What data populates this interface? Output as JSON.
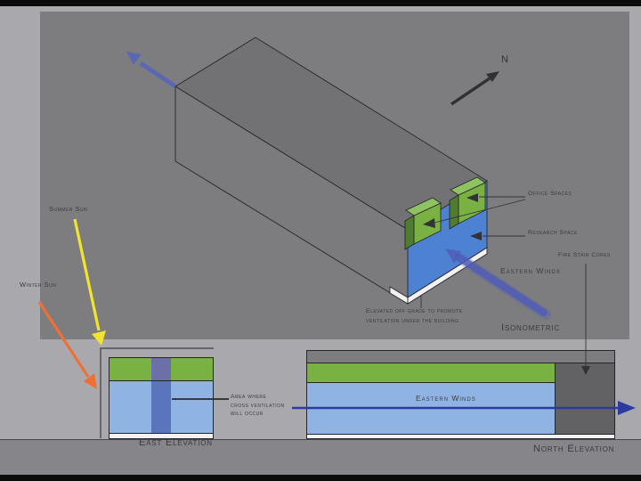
{
  "colors": {
    "page_bg": "#a9a9ad",
    "panel_bg": "#7d7d7f",
    "ground": "#86868a",
    "frame_black": "#0b0b0b",
    "green": "#79b243",
    "light_blue": "#8fb4e4",
    "mid_blue": "#4d82d3",
    "band_blue": "#5a74bd",
    "band_purple": "#6d6fa9",
    "core_gray": "#626264",
    "wind_blue": "#2c3aa0",
    "iso_wind": "#4f5cb8",
    "axis_blue": "#5a66b6",
    "sun_yellow": "#f1e42e",
    "sun_orange": "#ef7034",
    "white": "#f2f2f2"
  },
  "isometric_view": {
    "caption": "Isonometric",
    "compass_label": "N",
    "summer_sun_label": "Summer Sun",
    "winter_sun_label": "Winter Sun",
    "office_spaces_label": "Office Spaces",
    "research_space_label": "Research Space",
    "fire_stair_cores_label": "Fire Stair Cores",
    "eastern_winds_label": "Eastern Winds",
    "elevated_note_line1": "Elevated off grade to promote",
    "elevated_note_line2": "ventilation under the building"
  },
  "east_elevation": {
    "caption": "East Elevation",
    "note_line1": "Area where",
    "note_line2": "cross ventilation",
    "note_line3": "will occur"
  },
  "north_elevation": {
    "caption": "North Elevation",
    "eastern_winds_label": "Eastern Winds"
  }
}
